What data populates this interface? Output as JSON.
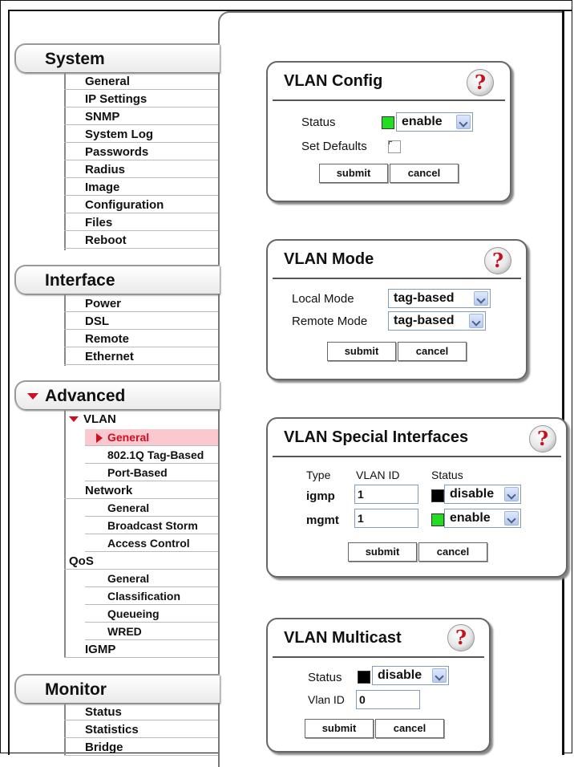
{
  "nav": {
    "system": {
      "label": "System",
      "items": [
        "General",
        "IP Settings",
        "SNMP",
        "System Log",
        "Passwords",
        "Radius",
        "Image",
        "Configuration",
        "Files",
        "Reboot"
      ]
    },
    "interface": {
      "label": "Interface",
      "items": [
        "Power",
        "DSL",
        "Remote",
        "Ethernet"
      ]
    },
    "advanced": {
      "label": "Advanced",
      "vlan": {
        "label": "VLAN",
        "items": [
          "General",
          "802.1Q Tag-Based",
          "Port-Based"
        ]
      },
      "network": {
        "label": "Network",
        "items": [
          "General",
          "Broadcast Storm",
          "Access Control"
        ]
      },
      "qos": {
        "label": "QoS",
        "items": [
          "General",
          "Classification",
          "Queueing",
          "WRED"
        ]
      },
      "igmp": {
        "label": "IGMP"
      }
    },
    "monitor": {
      "label": "Monitor",
      "items": [
        "Status",
        "Statistics",
        "Bridge"
      ]
    }
  },
  "vlan_config": {
    "title": "VLAN Config",
    "status_label": "Status",
    "status_value": "enable",
    "status_color": "#22dd22",
    "set_defaults_label": "Set Defaults",
    "submit": "submit",
    "cancel": "cancel"
  },
  "vlan_mode": {
    "title": "VLAN Mode",
    "local_label": "Local Mode",
    "local_value": "tag-based",
    "remote_label": "Remote Mode",
    "remote_value": "tag-based",
    "submit": "submit",
    "cancel": "cancel"
  },
  "vlan_special": {
    "title": "VLAN Special Interfaces",
    "headers": [
      "Type",
      "VLAN ID",
      "Status"
    ],
    "rows": [
      {
        "type": "igmp",
        "vlan_id": "1",
        "status": "disable",
        "color": "#000000"
      },
      {
        "type": "mgmt",
        "vlan_id": "1",
        "status": "enable",
        "color": "#22dd22"
      }
    ],
    "submit": "submit",
    "cancel": "cancel"
  },
  "vlan_multicast": {
    "title": "VLAN Multicast",
    "status_label": "Status",
    "status_value": "disable",
    "status_color": "#000000",
    "vlan_id_label": "Vlan ID",
    "vlan_id_value": "0",
    "submit": "submit",
    "cancel": "cancel"
  },
  "help_glyph": "?",
  "colors": {
    "accent_red": "#cc1020",
    "selected_bg": "#f9c9cf"
  }
}
